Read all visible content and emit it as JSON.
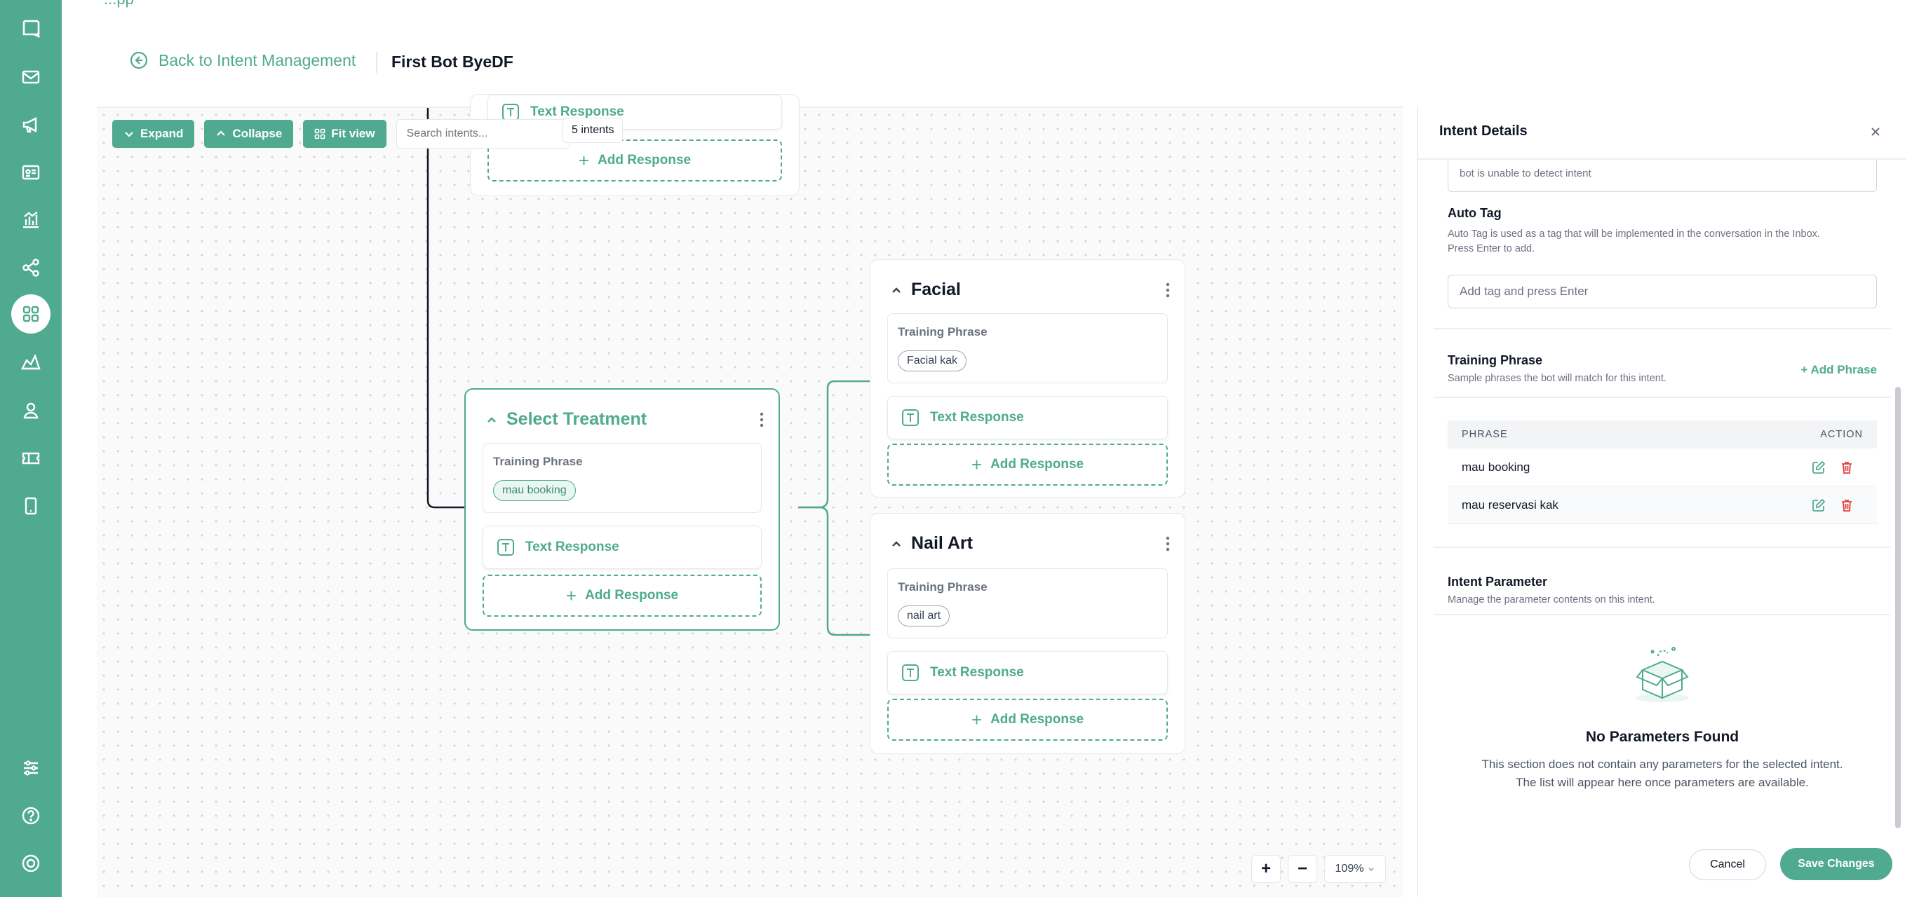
{
  "header": {
    "top_crumb": "...pp",
    "back_label": "Back to Intent Management",
    "bot_name": "First Bot ByeDF"
  },
  "toolbar": {
    "expand_label": "Expand",
    "collapse_label": "Collapse",
    "fit_label": "Fit view",
    "search_placeholder": "Search intents...",
    "intent_count": "5 intents"
  },
  "nodes": {
    "top": {
      "response_label": "Text Response",
      "add_response": "Add Response"
    },
    "select_treatment": {
      "title": "Select Treatment",
      "training_label": "Training Phrase",
      "chip": "mau booking",
      "response_label": "Text Response",
      "add_response": "Add Response"
    },
    "facial": {
      "title": "Facial",
      "training_label": "Training Phrase",
      "chip": "Facial kak",
      "response_label": "Text Response",
      "add_response": "Add Response"
    },
    "nail_art": {
      "title": "Nail Art",
      "training_label": "Training Phrase",
      "chip": "nail art",
      "response_label": "Text Response",
      "add_response": "Add Response"
    }
  },
  "zoom": {
    "level": "109%"
  },
  "panel": {
    "title": "Intent Details",
    "fallback_text": "bot is unable to detect intent",
    "auto_tag": {
      "title": "Auto Tag",
      "subtitle_line1": "Auto Tag is used as a tag that will be implemented in the conversation in the Inbox.",
      "subtitle_line2": "Press Enter to add.",
      "placeholder": "Add tag and press Enter"
    },
    "training": {
      "title": "Training Phrase",
      "subtitle": "Sample phrases the bot will match for this intent.",
      "add_label": "+ Add Phrase",
      "col_phrase": "PHRASE",
      "col_action": "ACTION",
      "rows": [
        "mau booking",
        "mau reservasi kak"
      ]
    },
    "parameter": {
      "title": "Intent Parameter",
      "subtitle": "Manage the parameter contents on this intent.",
      "empty_title": "No Parameters Found",
      "empty_line1": "This section does not contain any parameters for the selected intent.",
      "empty_line2": "The list will appear here once parameters are available."
    },
    "cancel_label": "Cancel",
    "save_label": "Save Changes"
  },
  "colors": {
    "brand": "#4faa8f",
    "danger": "#e53e3e"
  },
  "icons": {
    "rail": [
      "chat-icon",
      "mail-icon",
      "megaphone-icon",
      "contact-card-icon",
      "analytics-icon",
      "flow-icon",
      "apps-icon",
      "broadcast-icon",
      "user-icon",
      "ticket-icon",
      "mobile-icon",
      "settings-sliders-icon",
      "help-icon",
      "power-icon"
    ]
  }
}
